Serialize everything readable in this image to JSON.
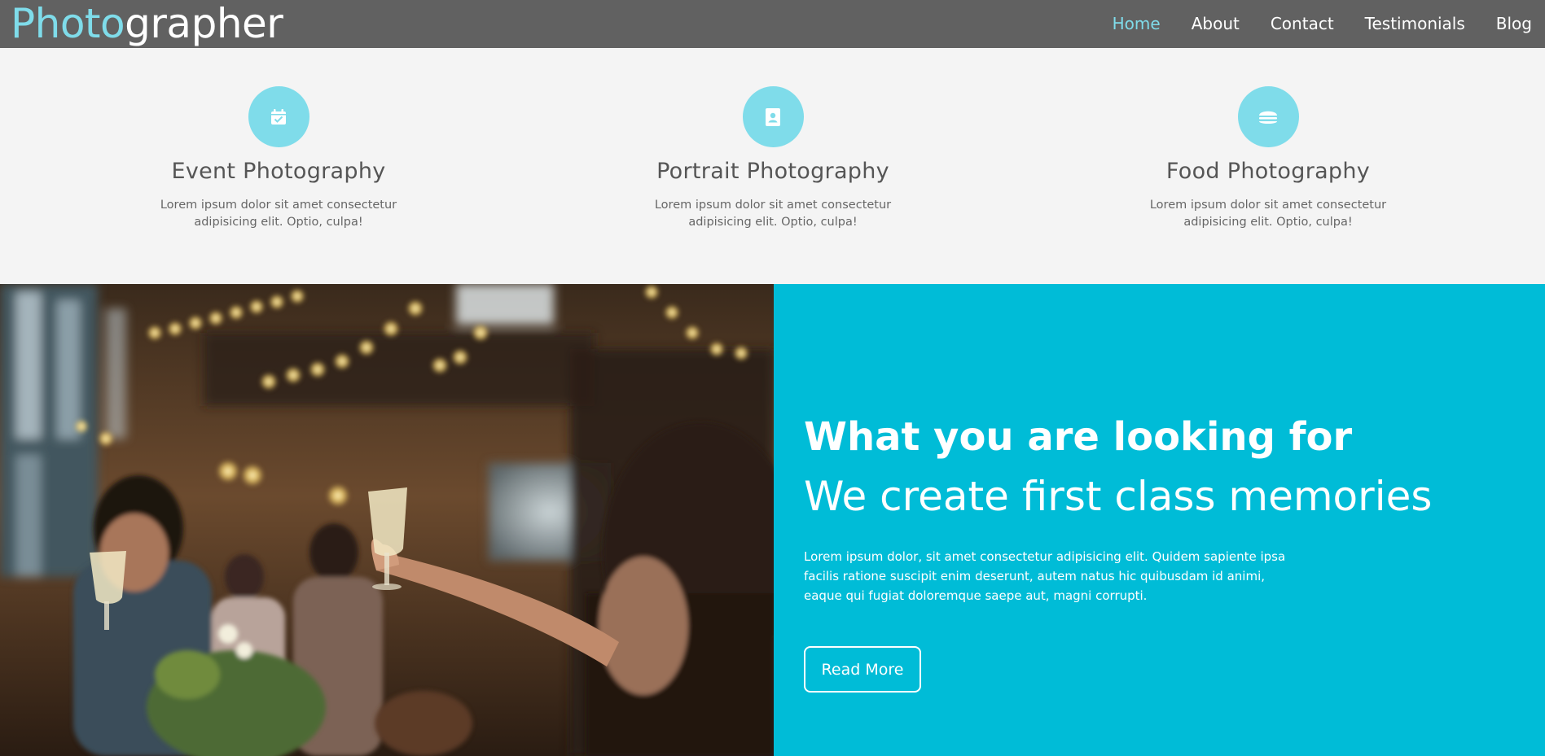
{
  "brand": {
    "accent": "Photo",
    "rest": "grapher"
  },
  "nav": {
    "items": [
      {
        "label": "Home",
        "active": true
      },
      {
        "label": "About",
        "active": false
      },
      {
        "label": "Contact",
        "active": false
      },
      {
        "label": "Testimonials",
        "active": false
      },
      {
        "label": "Blog",
        "active": false
      }
    ]
  },
  "services": [
    {
      "icon": "calendar-check-icon",
      "title": "Event Photography",
      "text": "Lorem ipsum dolor sit amet consectetur adipisicing elit. Optio, culpa!"
    },
    {
      "icon": "portrait-icon",
      "title": "Portrait Photography",
      "text": "Lorem ipsum dolor sit amet consectetur adipisicing elit. Optio, culpa!"
    },
    {
      "icon": "hamburger-icon",
      "title": "Food Photography",
      "text": "Lorem ipsum dolor sit amet consectetur adipisicing elit. Optio, culpa!"
    }
  ],
  "info": {
    "heading": "What you are looking for",
    "subheading": "We create first class memories",
    "body": "Lorem ipsum dolor, sit amet consectetur adipisicing elit. Quidem sapiente ipsa facilis ratione suscipit enim deserunt, autem natus hic quibusdam id animi, eaque qui fugiat doloremque saepe aut, magni corrupti.",
    "button_label": "Read More"
  },
  "colors": {
    "header_bg": "#616161",
    "accent": "#7fdcea",
    "info_bg": "#00bcd7",
    "section_bg": "#f4f4f4"
  }
}
